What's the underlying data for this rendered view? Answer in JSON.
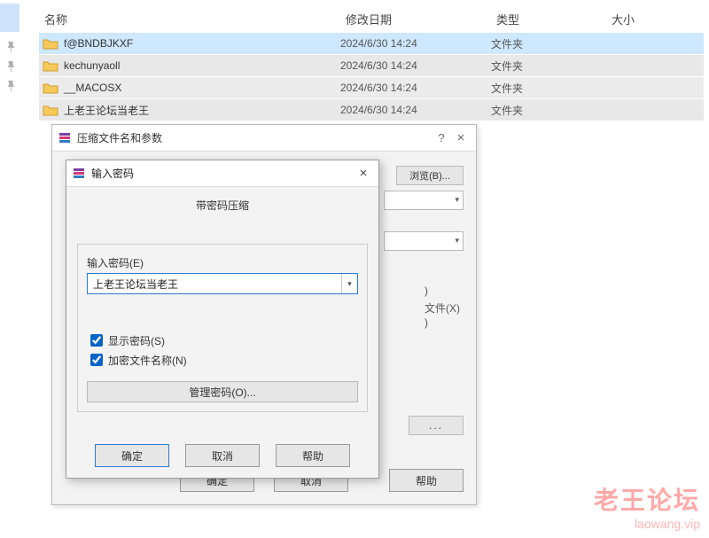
{
  "columns": {
    "name": "名称",
    "date": "修改日期",
    "type": "类型",
    "size": "大小"
  },
  "files": [
    {
      "name": "f@BNDBJKXF",
      "date": "2024/6/30 14:24",
      "type": "文件夹"
    },
    {
      "name": "kechunyaoll",
      "date": "2024/6/30 14:24",
      "type": "文件夹"
    },
    {
      "name": "__MACOSX",
      "date": "2024/6/30 14:24",
      "type": "文件夹"
    },
    {
      "name": "上老王论坛当老王",
      "date": "2024/6/30 14:24",
      "type": "文件夹"
    }
  ],
  "dlg1": {
    "title": "压缩文件名和参数",
    "browse": "浏览(B)...",
    "stub_d": ")",
    "stub_x": "文件(X)",
    "stub_s": ")",
    "dots": "...",
    "ok": "确定",
    "cancel": "取消",
    "help": "帮助"
  },
  "dlg2": {
    "title": "输入密码",
    "subtitle": "带密码压缩",
    "pw_label": "输入密码(E)",
    "pw_value": "上老王论坛当老王",
    "show_pw": "显示密码(S)",
    "enc_names": "加密文件名称(N)",
    "manage": "管理密码(O)...",
    "ok": "确定",
    "cancel": "取消",
    "help": "帮助"
  },
  "watermark": {
    "line1": "老王论坛",
    "line2": "laowang.vip"
  }
}
